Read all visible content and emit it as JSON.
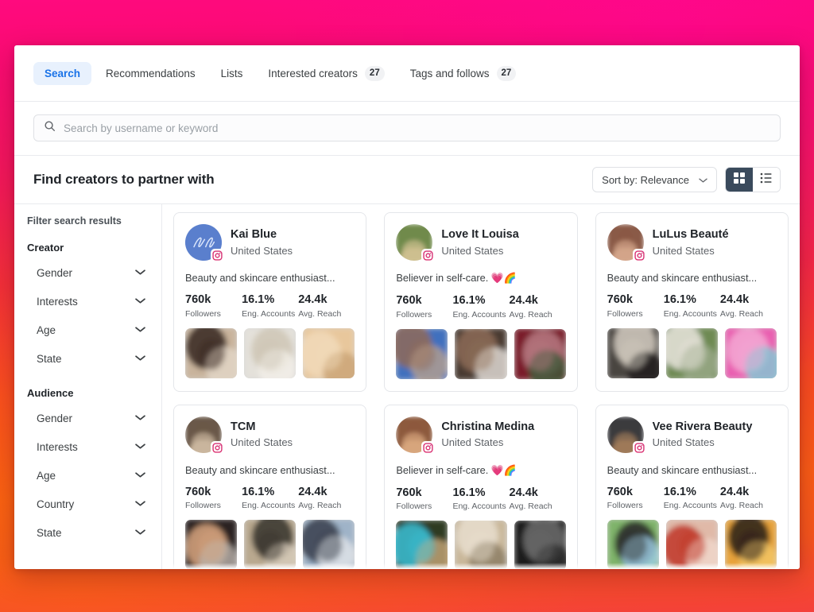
{
  "theme": {
    "accent": "#1a73e8",
    "accent_bg": "#e8f1fd",
    "toggle_active_bg": "#3a4a5c",
    "bg_gradient_top": "#ff0a7e",
    "bg_gradient_mid": "#f42b3c",
    "bg_gradient_bottom": "#fb5d15",
    "text_primary": "#1f2328",
    "text_secondary": "#5f6368",
    "border": "#e4e6ea"
  },
  "tabs": [
    {
      "label": "Search",
      "badge": null,
      "active": true
    },
    {
      "label": "Recommendations",
      "badge": null,
      "active": false
    },
    {
      "label": "Lists",
      "badge": null,
      "active": false
    },
    {
      "label": "Interested creators",
      "badge": "27",
      "active": false
    },
    {
      "label": "Tags and follows",
      "badge": "27",
      "active": false
    }
  ],
  "search": {
    "placeholder": "Search by username or keyword",
    "value": "",
    "icon": "search-icon"
  },
  "toolbar": {
    "title": "Find creators to partner with",
    "sort_label": "Sort by: Relevance",
    "sort_chevron": "chevron-down-icon",
    "view_grid": "grid-view-icon",
    "view_list": "list-view-icon",
    "active_view": "grid"
  },
  "sidebar": {
    "title": "Filter search results",
    "groups": [
      {
        "title": "Creator",
        "filters": [
          {
            "label": "Gender",
            "chevron": "chevron-down-icon"
          },
          {
            "label": "Interests",
            "chevron": "chevron-down-icon"
          },
          {
            "label": "Age",
            "chevron": "chevron-down-icon"
          },
          {
            "label": "State",
            "chevron": "chevron-down-icon"
          }
        ]
      },
      {
        "title": "Audience",
        "filters": [
          {
            "label": "Gender",
            "chevron": "chevron-down-icon"
          },
          {
            "label": "Interests",
            "chevron": "chevron-down-icon"
          },
          {
            "label": "Age",
            "chevron": "chevron-down-icon"
          },
          {
            "label": "Country",
            "chevron": "chevron-down-icon"
          },
          {
            "label": "State",
            "chevron": "chevron-down-icon"
          }
        ]
      }
    ]
  },
  "stat_labels": {
    "followers": "Followers",
    "engagement": "Eng. Accounts",
    "reach": "Avg. Reach"
  },
  "creators": [
    {
      "name": "Kai Blue",
      "country": "United States",
      "bio": "Beauty and skincare enthusiast...",
      "platform": "instagram-icon",
      "followers": "760k",
      "engagement": "16.1%",
      "reach": "24.4k",
      "avatar_colors": [
        "#4f76c8",
        "#6f93d8"
      ],
      "avatar_kind": "logo-monogram",
      "thumb_colors": [
        [
          "#c9b49c",
          "#3a2a22",
          "#e4d7c8"
        ],
        [
          "#e4e1da",
          "#cfc6b6",
          "#f2efe9"
        ],
        [
          "#e8c79c",
          "#f0d9b8",
          "#c9a275"
        ]
      ]
    },
    {
      "name": "Love It Louisa",
      "country": "United States",
      "bio": "Believer in self-care. 💗🌈",
      "platform": "instagram-icon",
      "followers": "760k",
      "engagement": "16.1%",
      "reach": "24.4k",
      "avatar_colors": [
        "#6f8a4c",
        "#cfc090"
      ],
      "avatar_kind": "portrait",
      "thumb_colors": [
        [
          "#3f6fbe",
          "#8d6a5c",
          "#b8a08f"
        ],
        [
          "#4a3a32",
          "#8a6a55",
          "#e6e2dc"
        ],
        [
          "#7a1f2a",
          "#b4777f",
          "#3c5a38"
        ]
      ]
    },
    {
      "name": "LuLus Beauté",
      "country": "United States",
      "bio": "Beauty and skincare enthusiast...",
      "platform": "instagram-icon",
      "followers": "760k",
      "engagement": "16.1%",
      "reach": "24.4k",
      "avatar_colors": [
        "#8a5a46",
        "#d4a58a"
      ],
      "avatar_kind": "portrait",
      "thumb_colors": [
        [
          "#4a4440",
          "#cfc8bd",
          "#1e1c1a"
        ],
        [
          "#6e8a52",
          "#e6e2da",
          "#9aa98a"
        ],
        [
          "#e95fb0",
          "#f2a6d2",
          "#7fc9d4"
        ]
      ]
    },
    {
      "name": "TCM",
      "country": "United States",
      "bio": "Beauty and skincare enthusiast...",
      "platform": "instagram-icon",
      "followers": "760k",
      "engagement": "16.1%",
      "reach": "24.4k",
      "avatar_colors": [
        "#6a5848",
        "#cbb79e"
      ],
      "avatar_kind": "portrait",
      "thumb_colors": [
        [
          "#2a2220",
          "#d4a27c",
          "#b9b2ab"
        ],
        [
          "#b9a98f",
          "#3a362f",
          "#d8cdbb"
        ],
        [
          "#9fb3c8",
          "#3b4250",
          "#e2e6ea"
        ]
      ]
    },
    {
      "name": "Christina Medina",
      "country": "United States",
      "bio": "Believer in self-care. 💗🌈",
      "platform": "instagram-icon",
      "followers": "760k",
      "engagement": "16.1%",
      "reach": "24.4k",
      "avatar_colors": [
        "#8d5a3e",
        "#d8a67e"
      ],
      "avatar_kind": "portrait",
      "thumb_colors": [
        [
          "#2e3a22",
          "#39bcd0",
          "#c8a878"
        ],
        [
          "#c9b79a",
          "#e6ddcc",
          "#8a7a62"
        ],
        [
          "#1a1a1a",
          "#6a6a6a",
          "#2e2e2e"
        ]
      ]
    },
    {
      "name": "Vee Rivera Beauty",
      "country": "United States",
      "bio": "Beauty and skincare enthusiast...",
      "platform": "instagram-icon",
      "followers": "760k",
      "engagement": "16.1%",
      "reach": "24.4k",
      "avatar_colors": [
        "#3a3a3c",
        "#a07a5a"
      ],
      "avatar_kind": "portrait",
      "thumb_colors": [
        [
          "#7fb46a",
          "#2a2a2a",
          "#9fd0e8"
        ],
        [
          "#e0b9a8",
          "#c0392b",
          "#f0d8cc"
        ],
        [
          "#e8a33a",
          "#2a2018",
          "#f2c766"
        ]
      ]
    }
  ]
}
